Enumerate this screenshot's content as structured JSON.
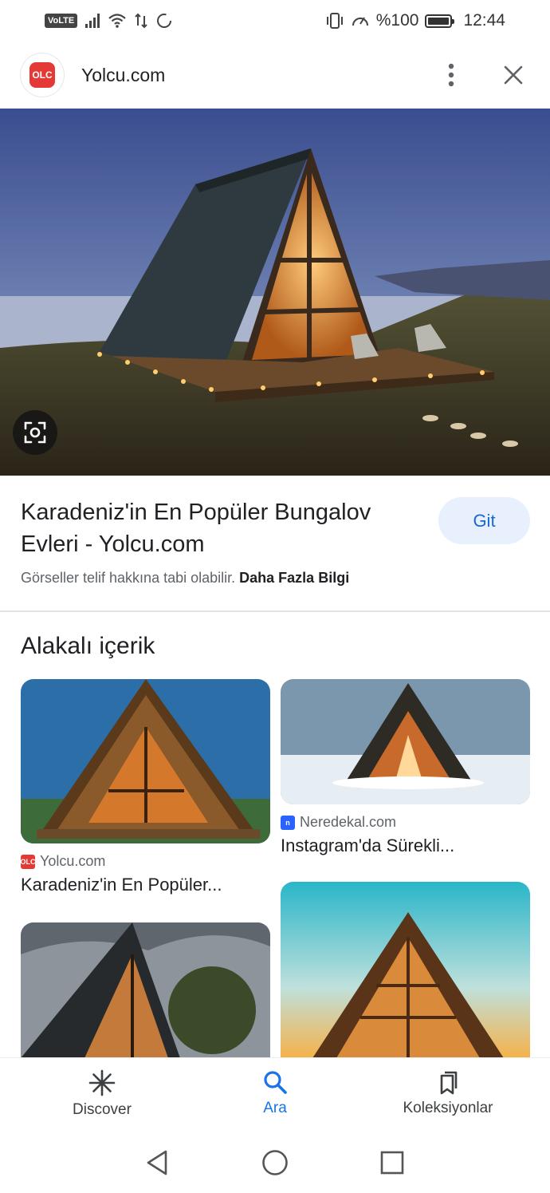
{
  "status_bar": {
    "volte": "VoLTE",
    "battery_text": "%100",
    "time": "12:44"
  },
  "header": {
    "favicon_text": "OLC",
    "site_name": "Yolcu.com"
  },
  "result": {
    "title": "Karadeniz'in En Popüler Bungalov Evleri - Yolcu.com",
    "go_button": "Git",
    "copyright_text": "Görseller telif hakkına tabi olabilir.",
    "learn_more": "Daha Fazla Bilgi"
  },
  "related": {
    "heading": "Alakalı içerik",
    "cards": [
      {
        "source": "Yolcu.com",
        "source_icon_text": "OLC",
        "title": "Karadeniz'in En Popüler..."
      },
      {
        "source": "Neredekal.com",
        "source_icon_text": "n",
        "title": "Instagram'da Sürekli..."
      }
    ]
  },
  "bottom_nav": {
    "items": [
      {
        "label": "Discover",
        "icon": "asterisk-icon"
      },
      {
        "label": "Ara",
        "icon": "search-icon"
      },
      {
        "label": "Koleksiyonlar",
        "icon": "collections-icon"
      }
    ],
    "active": "Ara"
  },
  "colors": {
    "accent": "#1a73e8",
    "button_bg": "#e8f0fe",
    "brand_red": "#e53935",
    "neredekal_blue": "#2962ff"
  }
}
